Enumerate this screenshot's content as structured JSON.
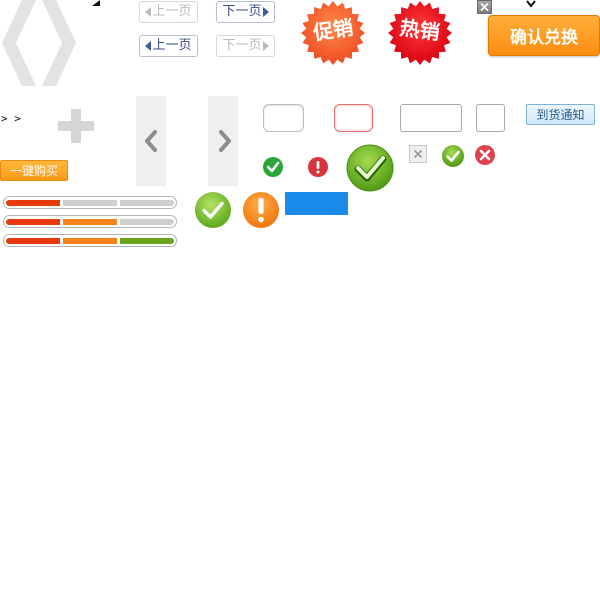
{
  "pager": {
    "prev_label": "上一页",
    "next_label": "下一页"
  },
  "promo": {
    "sale_label": "促销",
    "hot_label": "热销"
  },
  "buttons": {
    "confirm_exchange": "确认兑换",
    "arrival_notice": "到货通知",
    "one_click_buy": "一键购买"
  },
  "breadcrumb": {
    "arrows": "> >"
  },
  "progress": [
    {
      "filled_steps": 1,
      "total_steps": 3
    },
    {
      "filled_steps": 2,
      "total_steps": 3
    },
    {
      "filled_steps": 3,
      "total_steps": 3
    }
  ],
  "colors": {
    "orange_button": "#f98e17",
    "seal_red": "#e9101a",
    "seal_orange": "#f25a2c",
    "progress_red": "#e8390c",
    "progress_orange": "#f7821a",
    "progress_green": "#6aa41a",
    "progress_gray": "#cfcfcf",
    "blue_bar": "#1a8bea",
    "check_green": "#64b51f",
    "warn_orange": "#f48b1c"
  },
  "icons": [
    "angle-brackets-icon",
    "plus-icon",
    "chevron-left-icon",
    "chevron-right-icon",
    "close-icon",
    "chevron-down-icon",
    "check-circle-icon",
    "exclamation-circle-icon",
    "x-circle-icon"
  ]
}
